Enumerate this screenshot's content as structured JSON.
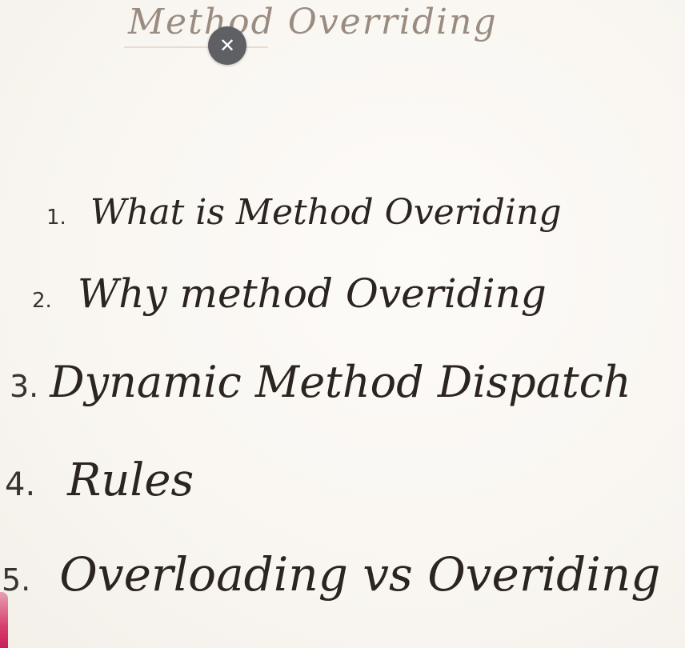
{
  "title": "Method Overriding",
  "close_button": {
    "glyph": "✕",
    "icon": "close-icon"
  },
  "items": [
    {
      "number": "1.",
      "text": "What is Method Overiding"
    },
    {
      "number": "2.",
      "text": "Why method Overiding"
    },
    {
      "number": "3.",
      "text": "Dynamic Method Dispatch"
    },
    {
      "number": "4.",
      "text": "Rules"
    },
    {
      "number": "5.",
      "text": "Overloading vs Overiding"
    }
  ],
  "colors": {
    "paper": "#fbf8f4",
    "ink": "#2b2420",
    "title_ink": "#8a7a6e",
    "close_button_bg": "#5f6064",
    "edge_marker": "#d8416e"
  }
}
